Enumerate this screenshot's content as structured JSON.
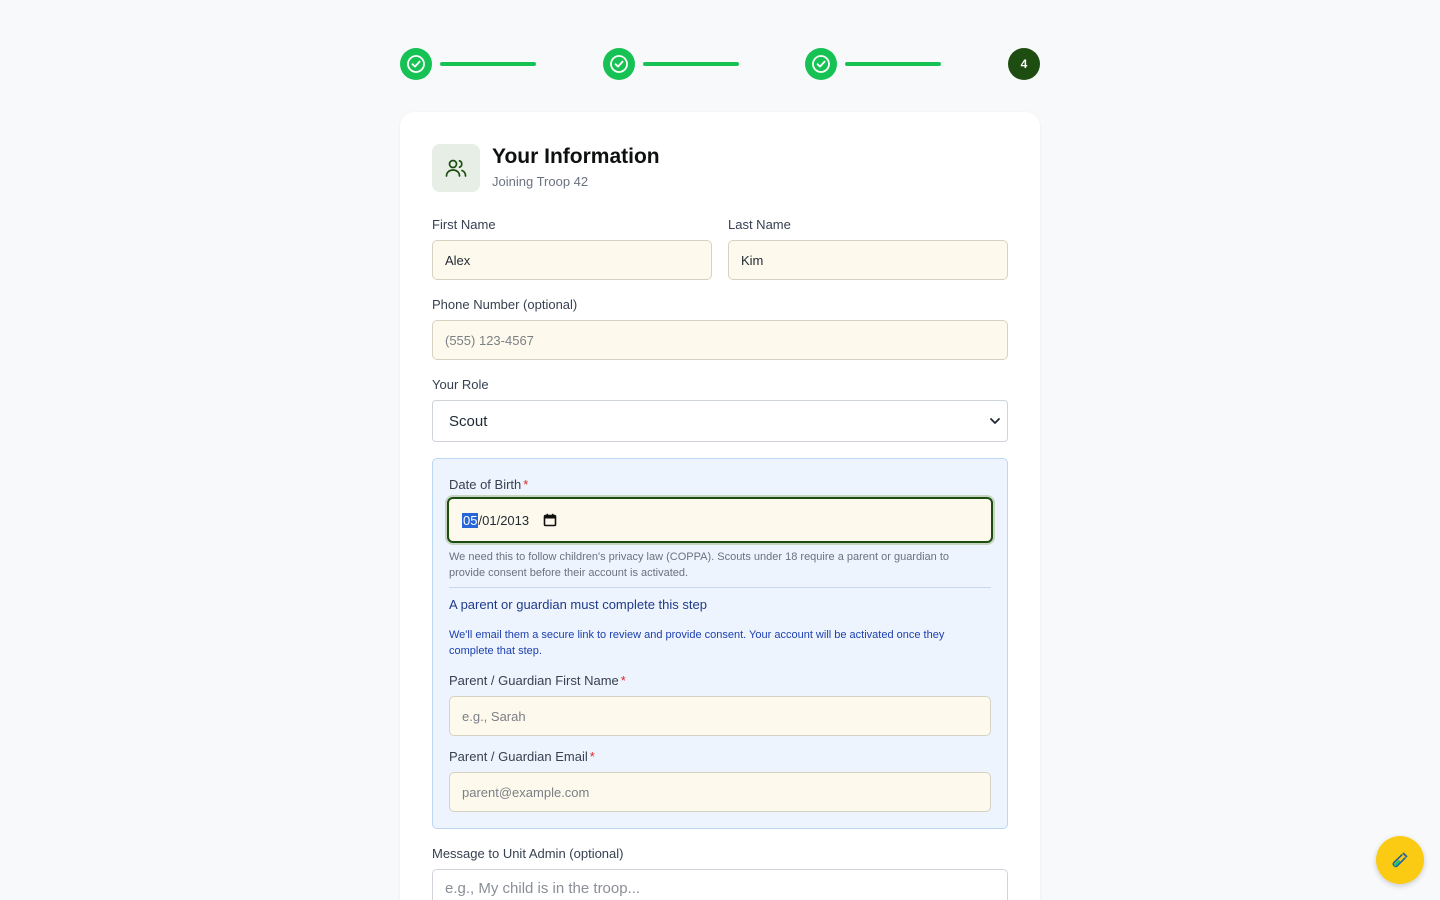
{
  "stepper": {
    "steps": [
      {
        "state": "done",
        "icon": "check-circle-icon"
      },
      {
        "state": "done",
        "icon": "check-circle-icon"
      },
      {
        "state": "done",
        "icon": "check-circle-icon"
      },
      {
        "state": "current",
        "label": "4"
      }
    ],
    "colors": {
      "done": "#16c253",
      "current": "#1e4d12"
    }
  },
  "header": {
    "icon": "users-icon",
    "title": "Your Information",
    "subtitle": "Joining Troop 42"
  },
  "form": {
    "first_name": {
      "label": "First Name",
      "value": "Alex"
    },
    "last_name": {
      "label": "Last Name",
      "value": "Kim"
    },
    "phone": {
      "label": "Phone Number (optional)",
      "placeholder": "(555) 123-4567"
    },
    "role": {
      "label": "Your Role",
      "selected": "Scout"
    },
    "dob": {
      "label": "Date of Birth",
      "required_mark": "*",
      "value_month": "05",
      "value_sep1": "/",
      "value_day": "01",
      "value_sep2": "/",
      "value_year": "2013",
      "help": "We need this to follow children's privacy law (COPPA). Scouts under 18 require a parent or guardian to provide consent before their account is activated."
    },
    "guardian": {
      "title": "A parent or guardian must complete this step",
      "description": "We'll email them a secure link to review and provide consent. Your account will be activated once they complete that step.",
      "first_name": {
        "label": "Parent / Guardian First Name",
        "required_mark": "*",
        "placeholder": "e.g., Sarah"
      },
      "email": {
        "label": "Parent / Guardian Email",
        "required_mark": "*",
        "placeholder": "parent@example.com"
      }
    },
    "message": {
      "label": "Message to Unit Admin (optional)",
      "placeholder": "e.g., My child is in the troop..."
    }
  },
  "fab": {
    "icon": "test-tube-icon",
    "color": "#fbcb14"
  }
}
